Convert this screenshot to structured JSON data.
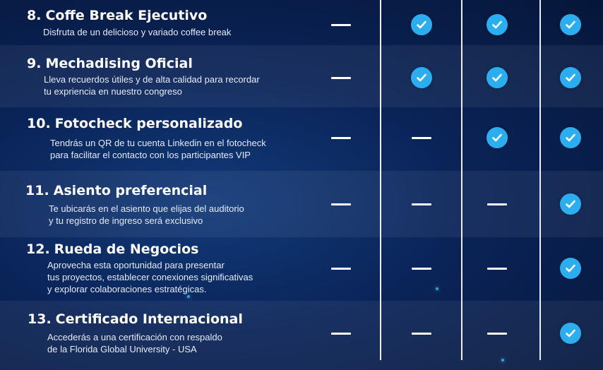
{
  "rows": [
    {
      "num": "8.",
      "title": "Coffe Break Ejecutivo",
      "desc": [
        "Disfruta de un delicioso y variado coffee break"
      ],
      "cols": [
        "dash",
        "check",
        "check",
        "check"
      ]
    },
    {
      "num": "9.",
      "title": "Mechadising Oficial",
      "desc": [
        "Lleva recuerdos útiles y de alta calidad para recordar",
        "tu expriencia en nuestro congreso"
      ],
      "cols": [
        "dash",
        "check",
        "check",
        "check"
      ]
    },
    {
      "num": "10.",
      "title": "Fotocheck personalizado",
      "desc": [
        "Tendrás un QR de tu cuenta Linkedin en el fotocheck",
        "para facilitar el contacto con los participantes VIP"
      ],
      "cols": [
        "dash",
        "dash",
        "check",
        "check"
      ]
    },
    {
      "num": "11.",
      "title": "Asiento preferencial",
      "desc": [
        "Te ubicarás en el asiento que elijas del auditorio",
        "y tu registro de ingreso será exclusivo"
      ],
      "cols": [
        "dash",
        "dash",
        "dash",
        "check"
      ]
    },
    {
      "num": "12.",
      "title": "Rueda de Negocios",
      "desc": [
        "Aprovecha esta oportunidad para presentar",
        "tus proyectos, establecer conexiones significativas",
        "y explorar colaboraciones estratégicas."
      ],
      "cols": [
        "dash",
        "dash",
        "dash",
        "check"
      ]
    },
    {
      "num": "13.",
      "title": "Certificado Internacional",
      "desc": [
        "Accederás a una certificación con respaldo",
        "de la Florida Global University - USA"
      ],
      "cols": [
        "dash",
        "dash",
        "dash",
        "check"
      ]
    }
  ],
  "icons": {
    "included": "check-circle-icon",
    "not_included": "dash-icon"
  },
  "colors": {
    "check": "#2aaef0",
    "background": "#0a2458"
  }
}
